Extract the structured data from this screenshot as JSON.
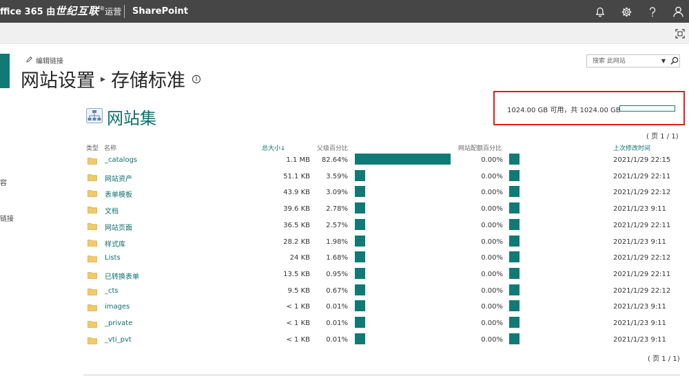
{
  "suite": {
    "brand_part1": "ffice 365 由",
    "brand_part2": "世纪互联",
    "brand_reg": "®",
    "brand_part3": "运营",
    "app_name": "SharePoint"
  },
  "icons": {
    "bell": "bell-icon",
    "settings": "gear-icon",
    "help": "help-icon",
    "user": "user-icon",
    "focus": "focus-mode-icon",
    "folder": "folder-icon",
    "site_collection": "site-collection-icon"
  },
  "nav": {
    "snippet_1": "容",
    "snippet_2": "链接"
  },
  "header": {
    "edit_links": "编辑链接",
    "crumb_root": "网站设置",
    "crumb_arrow": "▸",
    "crumb_current": "存储标准",
    "info": "i"
  },
  "search": {
    "placeholder": "搜索 此网站",
    "dropdown": "▼"
  },
  "section": {
    "title": "网站集"
  },
  "quota": {
    "text": "1024.00 GB 可用，共 1024.00 GB",
    "available_fraction": 1.0
  },
  "pager": {
    "top": "( 页 1 / 1)",
    "bottom": "( 页 1 / 1)"
  },
  "columns": {
    "type": "类型",
    "name": "名称",
    "size": "总大小",
    "sort_arrow": "↓",
    "parent_pct": "父级百分比",
    "quota_pct": "网站配额百分比",
    "modified": "上次修改时间"
  },
  "colors": {
    "accent": "#0f7a76",
    "link": "#0f6e6e",
    "highlight": "#e01e1e",
    "suitebar": "#464646"
  },
  "rows": [
    {
      "name": "_catalogs",
      "size": "1.1 MB",
      "parent_pct": "82.64%",
      "parent_value": 82.64,
      "quota_pct": "0.00%",
      "modified": "2021/1/29 22:15"
    },
    {
      "name": "网站资产",
      "size": "51.1 KB",
      "parent_pct": "3.59%",
      "parent_value": 3.59,
      "quota_pct": "0.00%",
      "modified": "2021/1/29 22:11"
    },
    {
      "name": "表单模板",
      "size": "43.9 KB",
      "parent_pct": "3.09%",
      "parent_value": 3.09,
      "quota_pct": "0.00%",
      "modified": "2021/1/29 22:12"
    },
    {
      "name": "文档",
      "size": "39.6 KB",
      "parent_pct": "2.78%",
      "parent_value": 2.78,
      "quota_pct": "0.00%",
      "modified": "2021/1/23 9:11"
    },
    {
      "name": "网站页面",
      "size": "36.5 KB",
      "parent_pct": "2.57%",
      "parent_value": 2.57,
      "quota_pct": "0.00%",
      "modified": "2021/1/29 22:11"
    },
    {
      "name": "样式库",
      "size": "28.2 KB",
      "parent_pct": "1.98%",
      "parent_value": 1.98,
      "quota_pct": "0.00%",
      "modified": "2021/1/23 9:11"
    },
    {
      "name": "Lists",
      "size": "24 KB",
      "parent_pct": "1.68%",
      "parent_value": 1.68,
      "quota_pct": "0.00%",
      "modified": "2021/1/29 22:12"
    },
    {
      "name": "已转换表单",
      "size": "13.5 KB",
      "parent_pct": "0.95%",
      "parent_value": 0.95,
      "quota_pct": "0.00%",
      "modified": "2021/1/29 22:11"
    },
    {
      "name": "_cts",
      "size": "9.5 KB",
      "parent_pct": "0.67%",
      "parent_value": 0.67,
      "quota_pct": "0.00%",
      "modified": "2021/1/29 22:12"
    },
    {
      "name": "images",
      "size": "< 1 KB",
      "parent_pct": "0.01%",
      "parent_value": 0.01,
      "quota_pct": "0.00%",
      "modified": "2021/1/23 9:11"
    },
    {
      "name": "_private",
      "size": "< 1 KB",
      "parent_pct": "0.01%",
      "parent_value": 0.01,
      "quota_pct": "0.00%",
      "modified": "2021/1/23 9:11"
    },
    {
      "name": "_vti_pvt",
      "size": "< 1 KB",
      "parent_pct": "0.01%",
      "parent_value": 0.01,
      "quota_pct": "0.00%",
      "modified": "2021/1/23 9:11"
    }
  ]
}
